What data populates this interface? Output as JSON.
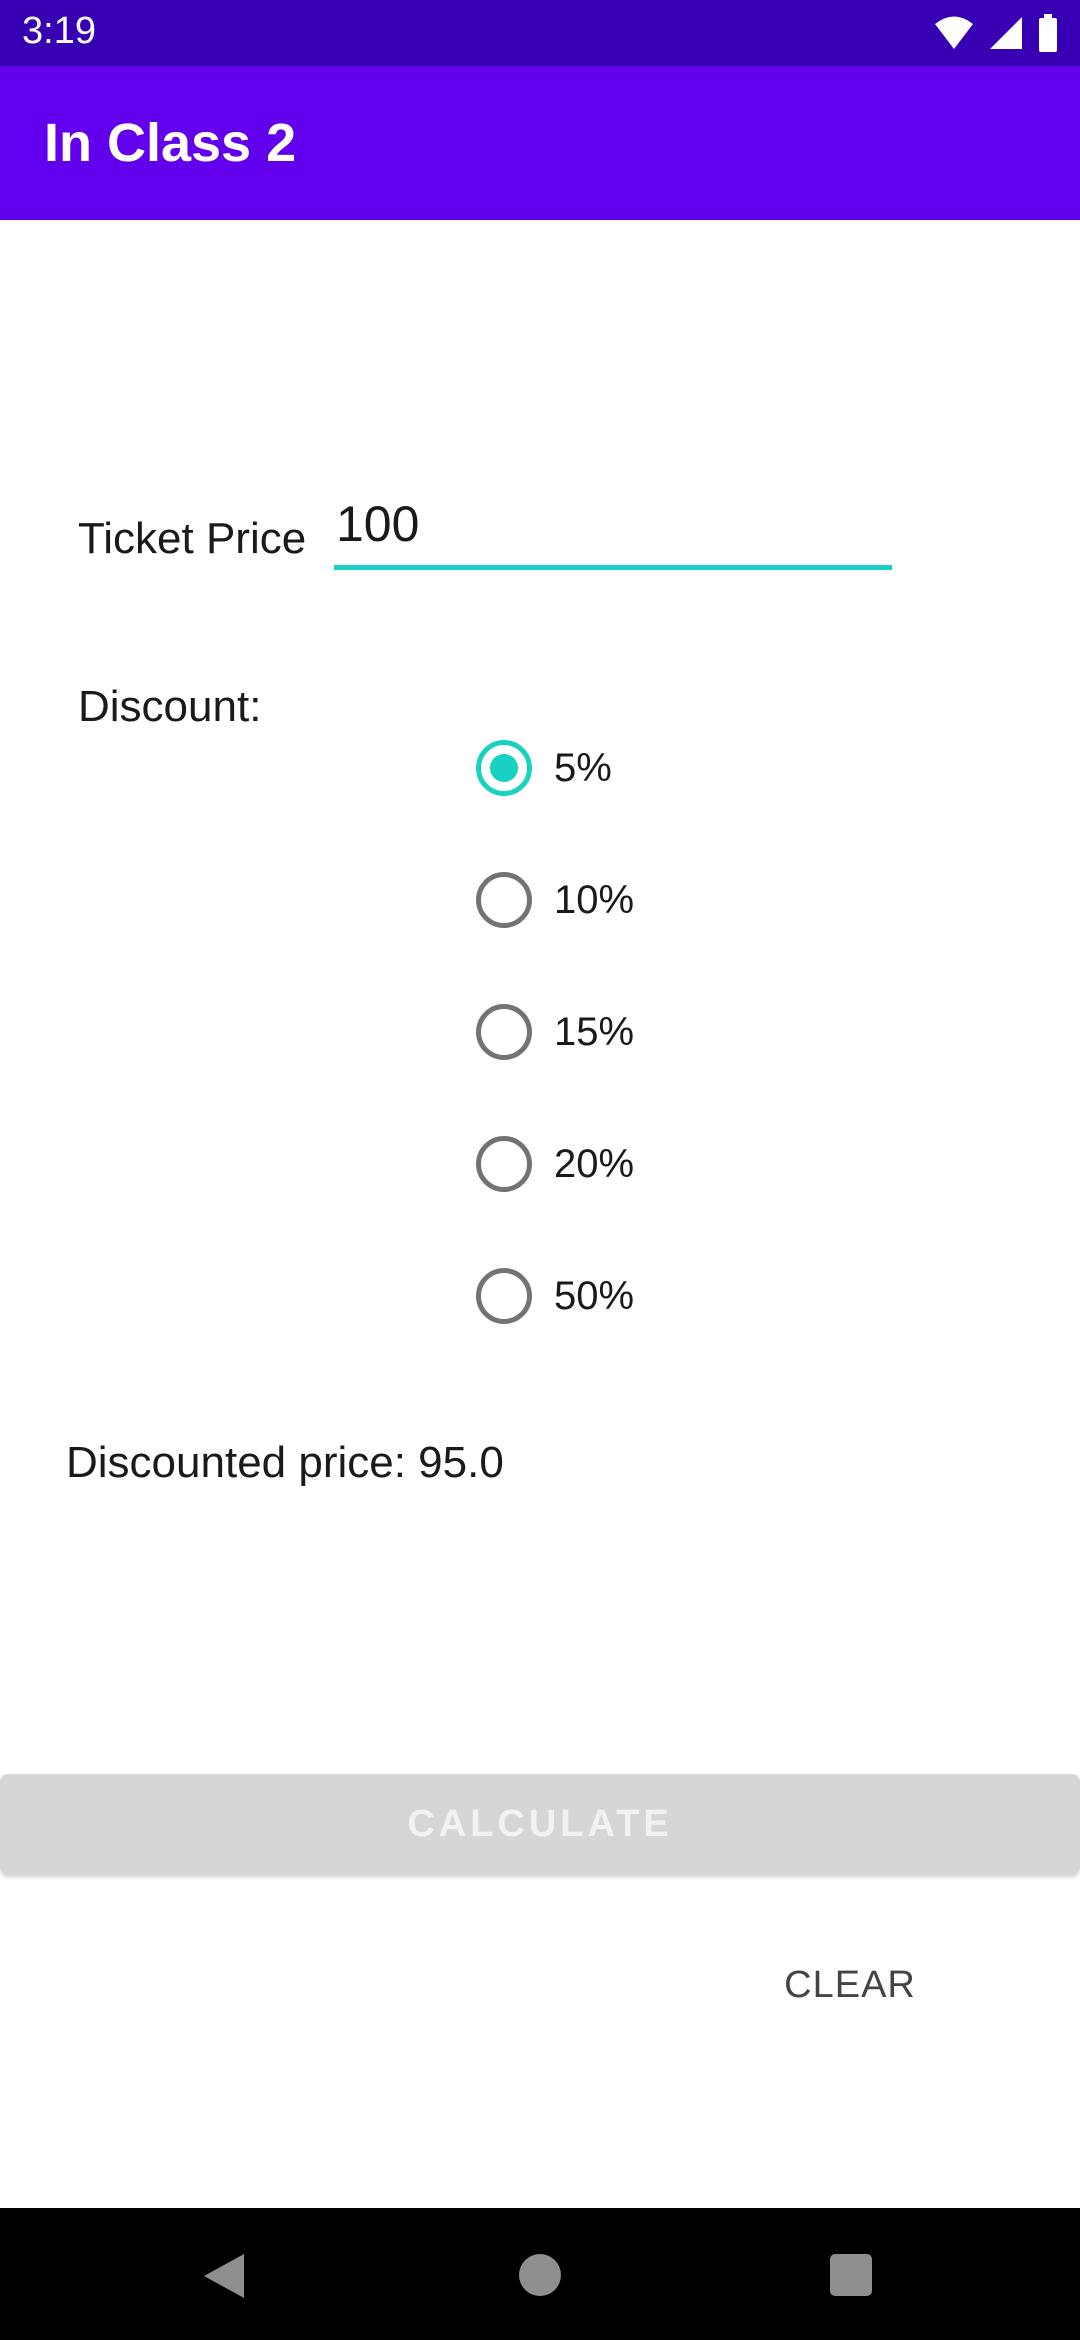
{
  "status_bar": {
    "time": "3:19",
    "icons": [
      "wifi-icon",
      "signal-icon",
      "battery-icon"
    ]
  },
  "app_bar": {
    "title": "In Class 2"
  },
  "form": {
    "ticket_price_label": "Ticket Price",
    "ticket_price_value": "100",
    "discount_label": "Discount:",
    "discount_options": [
      {
        "label": "5%",
        "checked": true
      },
      {
        "label": "10%",
        "checked": false
      },
      {
        "label": "15%",
        "checked": false
      },
      {
        "label": "20%",
        "checked": false
      },
      {
        "label": "50%",
        "checked": false
      }
    ],
    "result_text": "Discounted price: 95.0"
  },
  "buttons": {
    "calculate_label": "CALCULATE",
    "calculate_enabled": false,
    "clear_label": "CLEAR"
  },
  "nav_bar": {
    "icons": [
      "back-icon",
      "home-icon",
      "recent-apps-icon"
    ]
  },
  "colors": {
    "status_bar": "#3700b3",
    "app_bar": "#6200ee",
    "accent": "#18d1c3",
    "disabled_button": "#d6d6d6"
  }
}
